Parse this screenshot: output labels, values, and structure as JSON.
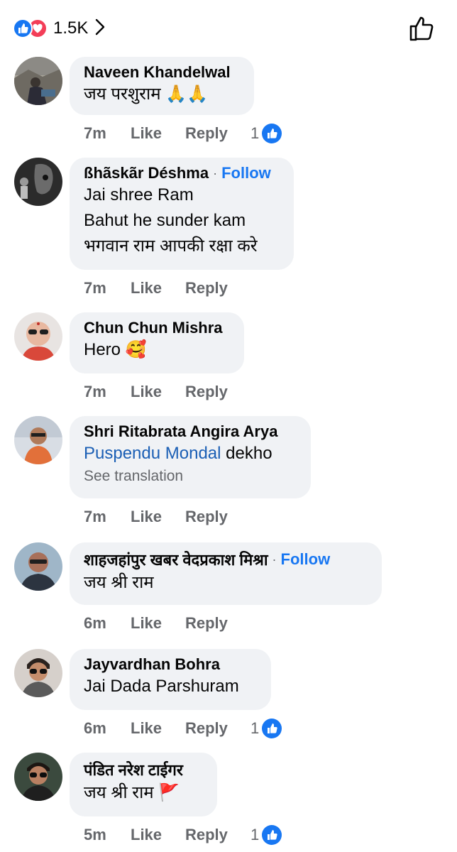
{
  "header": {
    "reaction_count": "1.5K",
    "reaction_icons": [
      "like-reaction-icon",
      "love-reaction-icon"
    ]
  },
  "colors": {
    "like_blue": "#1877f2",
    "love_red": "#f33e58",
    "bubble_bg": "#f0f2f5",
    "secondary_text": "#65676b"
  },
  "actions": {
    "like_label": "Like",
    "reply_label": "Reply",
    "follow_label": "Follow",
    "separator": "·"
  },
  "comments": [
    {
      "name": "Naveen Khandelwal",
      "lines": [
        "जय परशुराम 🙏🙏"
      ],
      "time": "7m",
      "reactions": "1"
    },
    {
      "name": "ßhãskãr Déshma",
      "follow": true,
      "lines": [
        "Jai shree Ram",
        "Bahut he sunder kam",
        "भगवान राम आपकी रक्षा करे"
      ],
      "time": "7m"
    },
    {
      "name": "Chun Chun Mishra",
      "lines": [
        "Hero 🥰"
      ],
      "time": "7m"
    },
    {
      "name": "Shri Ritabrata Angira Arya",
      "mention": "Puspendu Mondal",
      "mention_suffix": " dekho",
      "translation": "See translation",
      "time": "7m"
    },
    {
      "name": "शाहजहांपुर खबर वेदप्रकाश मिश्रा",
      "follow": true,
      "lines": [
        "जय श्री राम"
      ],
      "time": "6m"
    },
    {
      "name": "Jayvardhan Bohra",
      "lines": [
        "Jai Dada Parshuram"
      ],
      "time": "6m",
      "reactions": "1"
    },
    {
      "name": "पंडित नरेश टाईगर",
      "lines": [
        "जय श्री राम 🚩"
      ],
      "time": "5m",
      "reactions": "1"
    }
  ]
}
